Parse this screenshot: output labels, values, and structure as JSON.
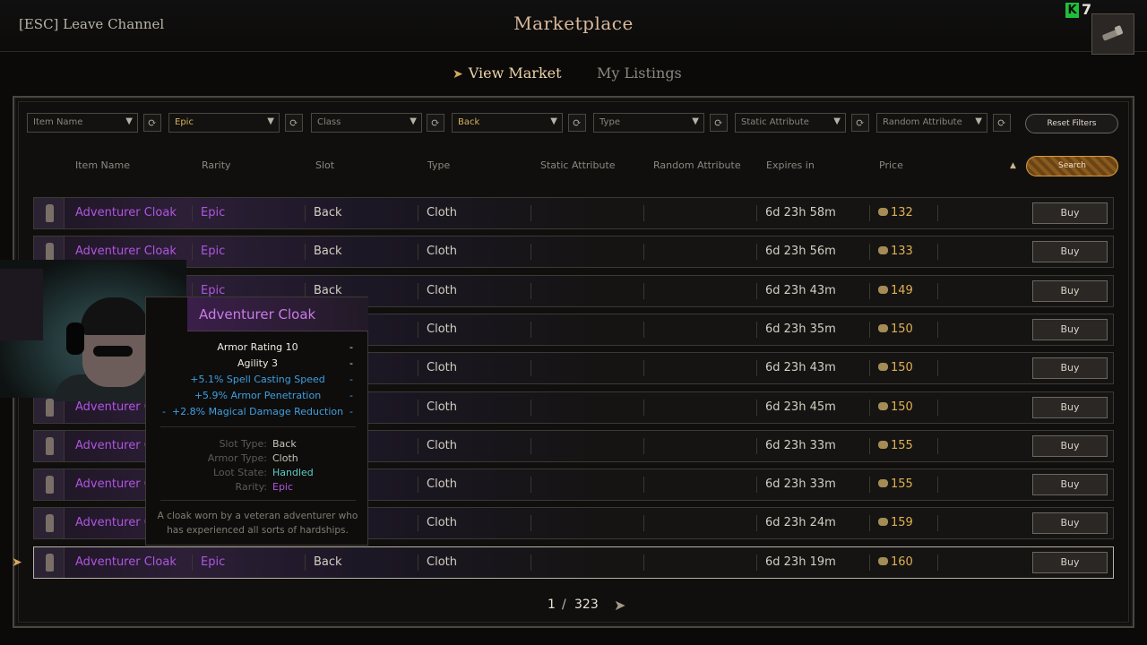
{
  "header": {
    "leave_label": "[ESC] Leave Channel",
    "title": "Marketplace",
    "currency_count": "7",
    "currency_icon": "k-coin-icon"
  },
  "tabs": [
    {
      "label": "View Market",
      "active": true
    },
    {
      "label": "My Listings",
      "active": false
    }
  ],
  "filters": [
    {
      "label": "Item Name",
      "active": false
    },
    {
      "label": "Epic",
      "active": true
    },
    {
      "label": "Class",
      "active": false
    },
    {
      "label": "Back",
      "active": true
    },
    {
      "label": "Type",
      "active": false
    },
    {
      "label": "Static Attribute",
      "active": false
    },
    {
      "label": "Random Attribute",
      "active": false
    }
  ],
  "reset_label": "Reset Filters",
  "search_label": "Search",
  "columns": [
    "Item Name",
    "Rarity",
    "Slot",
    "Type",
    "Static Attribute",
    "Random Attribute",
    "Expires in",
    "Price"
  ],
  "buy_label": "Buy",
  "rows": [
    {
      "name": "Adventurer Cloak",
      "rarity": "Epic",
      "slot": "Back",
      "type": "Cloth",
      "expires": "6d 23h 58m",
      "price": "132"
    },
    {
      "name": "Adventurer Cloak",
      "rarity": "Epic",
      "slot": "Back",
      "type": "Cloth",
      "expires": "6d 23h 56m",
      "price": "133"
    },
    {
      "name": "",
      "rarity": "Epic",
      "slot": "Back",
      "type": "Cloth",
      "expires": "6d 23h 43m",
      "price": "149"
    },
    {
      "name": "",
      "rarity": "",
      "slot": "",
      "type": "Cloth",
      "expires": "6d 23h 35m",
      "price": "150"
    },
    {
      "name": "",
      "rarity": "",
      "slot": "",
      "type": "Cloth",
      "expires": "6d 23h 43m",
      "price": "150"
    },
    {
      "name": "Adventurer C",
      "rarity": "",
      "slot": "",
      "type": "Cloth",
      "expires": "6d 23h 45m",
      "price": "150"
    },
    {
      "name": "Adventurer C",
      "rarity": "",
      "slot": "",
      "type": "Cloth",
      "expires": "6d 23h 33m",
      "price": "155"
    },
    {
      "name": "Adventurer C",
      "rarity": "",
      "slot": "",
      "type": "Cloth",
      "expires": "6d 23h 33m",
      "price": "155"
    },
    {
      "name": "Adventurer C",
      "rarity": "",
      "slot": "",
      "type": "Cloth",
      "expires": "6d 23h 24m",
      "price": "159"
    },
    {
      "name": "Adventurer Cloak",
      "rarity": "Epic",
      "slot": "Back",
      "type": "Cloth",
      "expires": "6d 23h 19m",
      "price": "160",
      "selected": true
    }
  ],
  "pagination": {
    "current": "1",
    "separator": "/",
    "total": "323"
  },
  "tooltip": {
    "name": "Adventurer Cloak",
    "base_stats": [
      "Armor Rating 10",
      "Agility 3"
    ],
    "bonus_stats": [
      "+5.1% Spell Casting Speed",
      "+5.9% Armor Penetration",
      "+2.8% Magical Damage Reduction"
    ],
    "dash": "-",
    "details": [
      {
        "key": "Slot Type:",
        "value": "Back",
        "color": "#c9c3b6"
      },
      {
        "key": "Armor Type:",
        "value": "Cloth",
        "color": "#c9c3b6"
      },
      {
        "key": "Loot State:",
        "value": "Handled",
        "color": "#5fc9c4"
      },
      {
        "key": "Rarity:",
        "value": "Epic",
        "color": "#b055e0"
      }
    ],
    "description": "A cloak worn by a veteran adventurer who has experienced all sorts of hardships."
  },
  "colors": {
    "epic": "#b055e0",
    "price": "#e0b052",
    "accent": "#d6a85f",
    "stat_blue": "#3f9fe0"
  }
}
